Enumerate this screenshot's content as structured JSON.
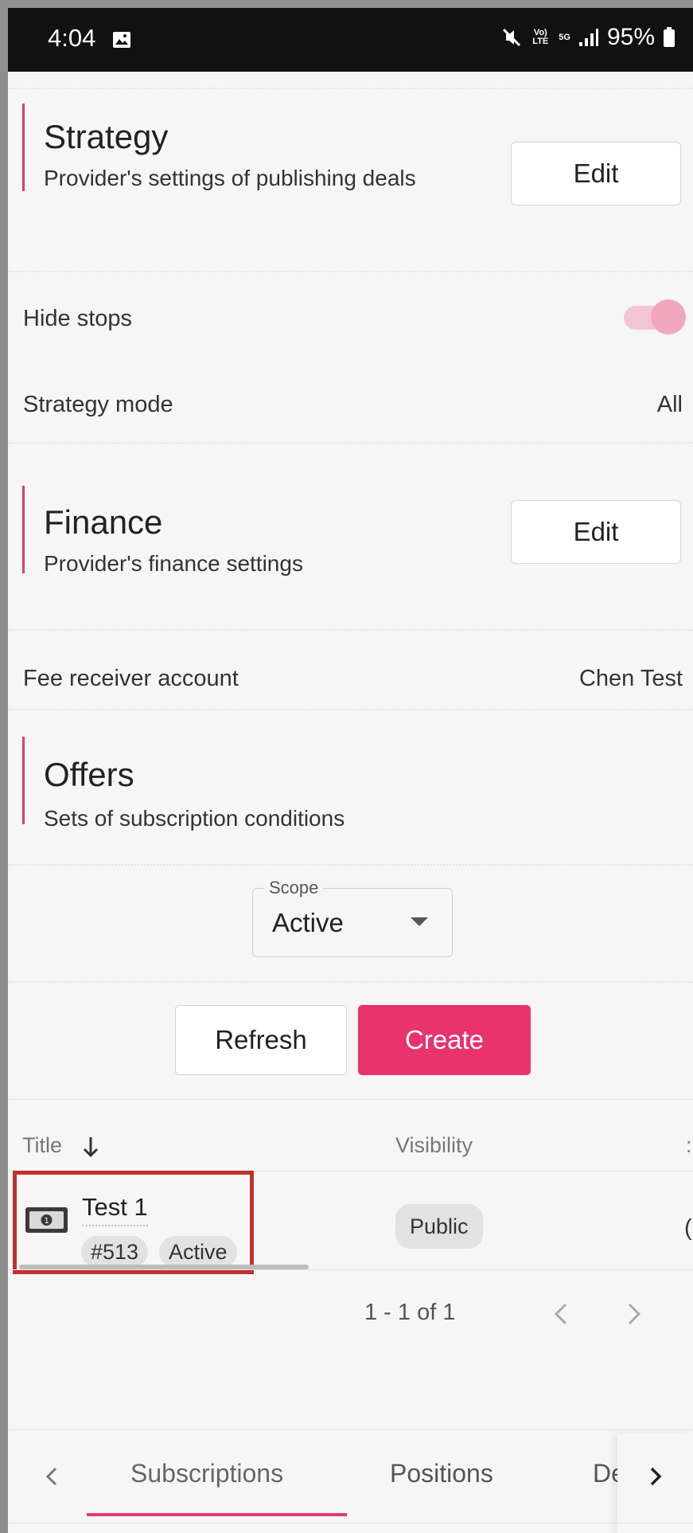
{
  "status_bar": {
    "time": "4:04",
    "battery": "95%",
    "network_volte": "Vo) LTE",
    "network_5g": "5G",
    "icons": [
      "image-icon",
      "mute-icon",
      "signal-icon",
      "battery-icon"
    ]
  },
  "strategy": {
    "title": "Strategy",
    "subtitle": "Provider's settings of publishing deals",
    "edit_label": "Edit"
  },
  "settings": {
    "hide_stops_label": "Hide stops",
    "hide_stops_on": true,
    "strategy_mode_label": "Strategy mode",
    "strategy_mode_value": "All"
  },
  "finance": {
    "title": "Finance",
    "subtitle": "Provider's finance settings",
    "edit_label": "Edit",
    "fee_receiver_label": "Fee receiver account",
    "fee_receiver_value": "Chen Test"
  },
  "offers": {
    "title": "Offers",
    "subtitle": "Sets of subscription conditions",
    "scope_label": "Scope",
    "scope_value": "Active",
    "refresh_label": "Refresh",
    "create_label": "Create"
  },
  "table": {
    "columns": [
      "Title",
      "Visibility"
    ],
    "rows": [
      {
        "title": "Test 1",
        "id_chip": "#513",
        "status_chip": "Active",
        "visibility": "Public"
      }
    ],
    "pagination": "1 - 1 of 1"
  },
  "tabs": {
    "items": [
      "Subscriptions",
      "Positions",
      "De"
    ],
    "active": "Subscriptions"
  },
  "colors": {
    "accent": "#e33b6f",
    "create_button": "#e8336d",
    "highlight_box": "#c0302f"
  }
}
